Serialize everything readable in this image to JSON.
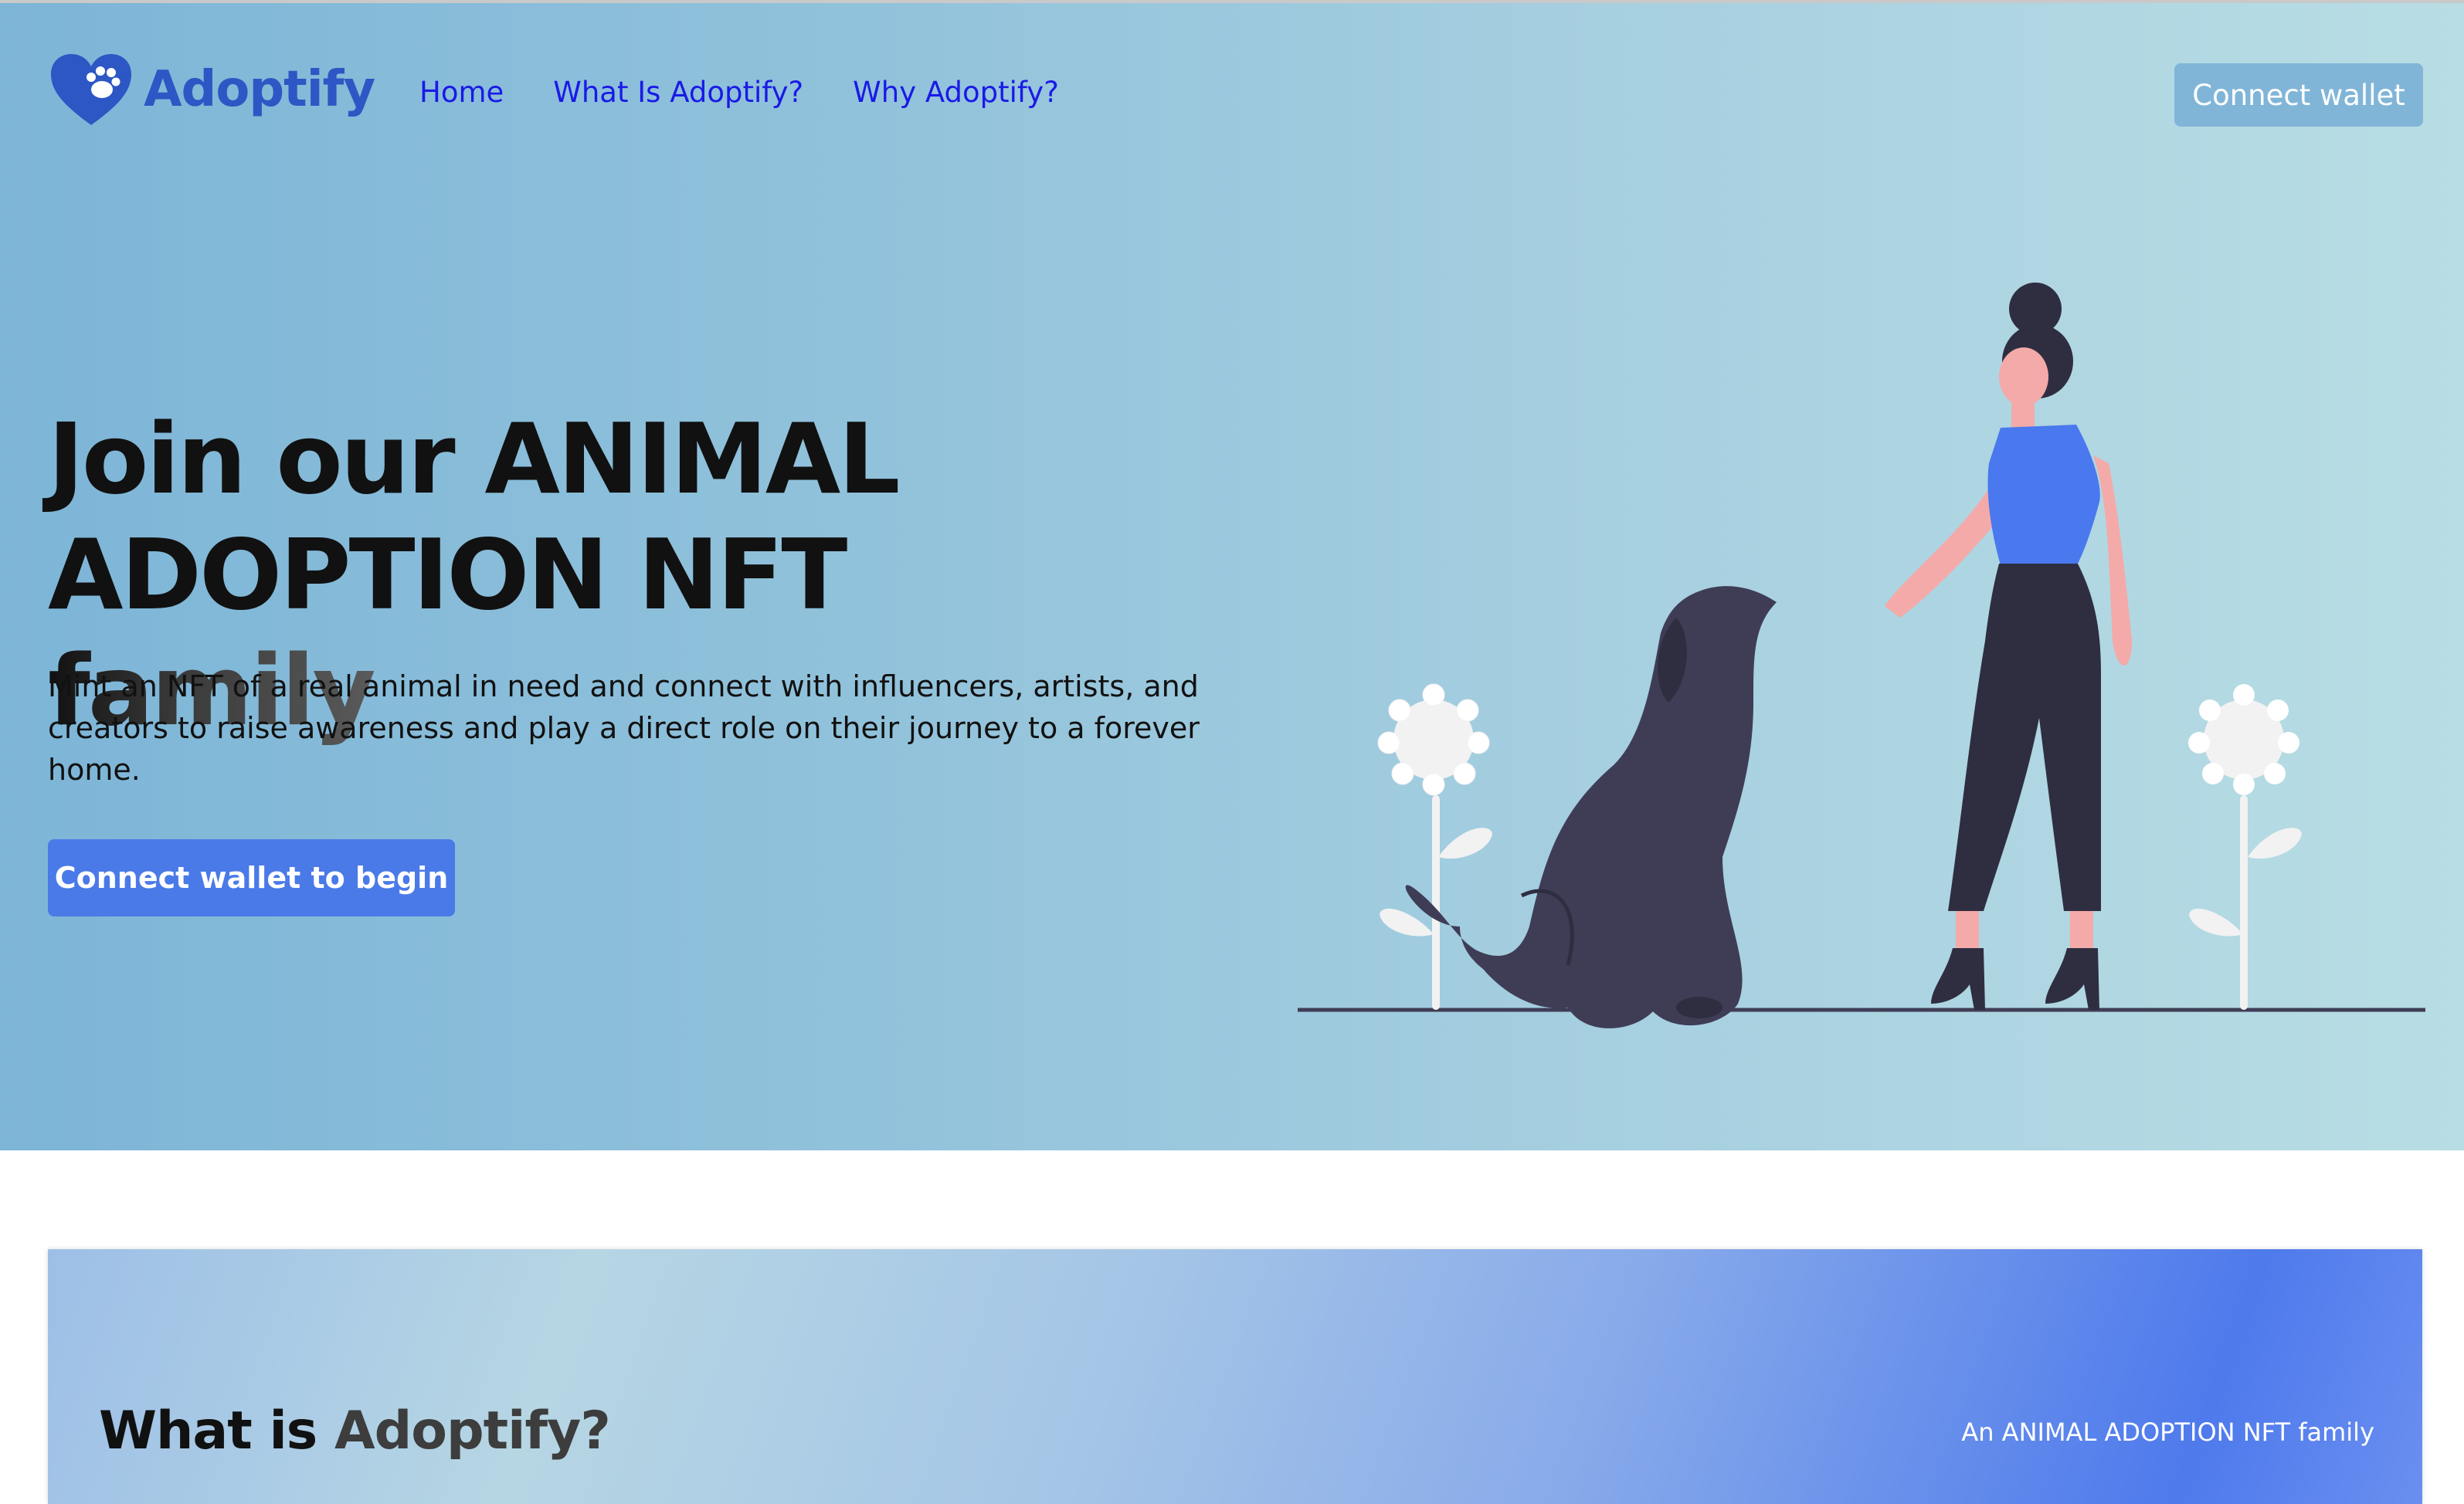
{
  "header": {
    "brand": "Adoptify",
    "nav": [
      {
        "label": "Home"
      },
      {
        "label": "What Is Adoptify?"
      },
      {
        "label": "Why Adoptify?"
      }
    ],
    "connect_wallet": "Connect wallet"
  },
  "hero": {
    "headline_part1": "Join our ",
    "headline_part2": "ANIMAL ADOPTION NFT",
    "headline_part3": " family",
    "description": "Mint an NFT of a real animal in need and connect with influencers, artists, and creators to raise awareness and play a direct role on their journey to a forever home.",
    "cta": "Connect wallet to begin"
  },
  "about": {
    "title_part1": "What is ",
    "title_part2": "Adoptify?",
    "tagline": "An ANIMAL ADOPTION NFT family"
  },
  "colors": {
    "brand_blue": "#2d57c4",
    "nav_link": "#1a1ae6",
    "cta_blue": "#4a7ae8",
    "connect_button": "#80b5d8",
    "shirt_blue": "#4a78ee",
    "dark_figure": "#3f3d56"
  },
  "icons": [
    "heart-paw-icon"
  ]
}
